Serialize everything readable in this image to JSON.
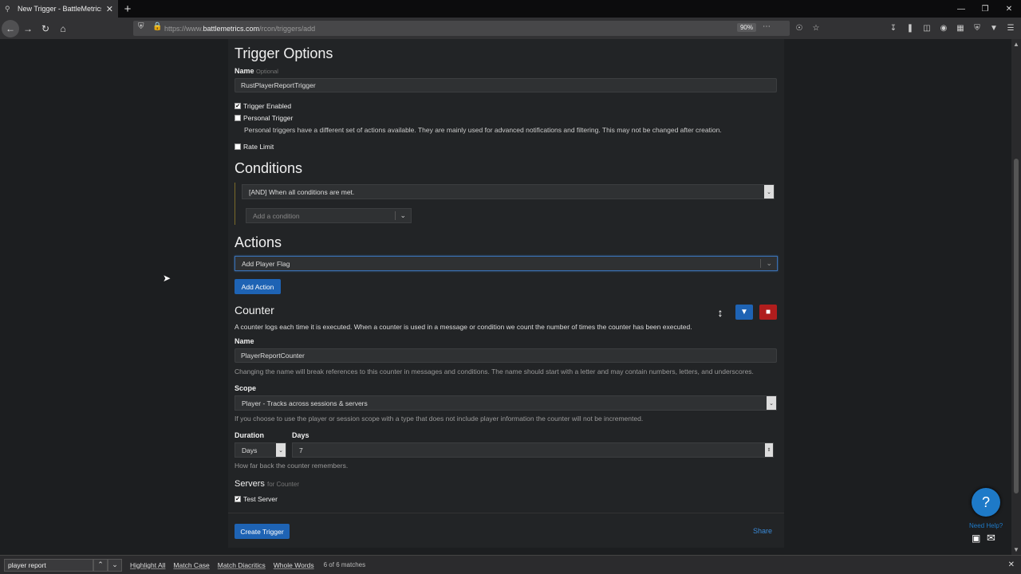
{
  "browser": {
    "tab_title": "New Trigger - BattleMetrics",
    "url_prefix": "https://www.",
    "url_domain": "battlemetrics.com",
    "url_path": "/rcon/triggers/add",
    "zoom": "90%"
  },
  "trigger_options": {
    "heading": "Trigger Options",
    "name_label": "Name",
    "name_optional": "Optional",
    "name_value": "RustPlayerReportTrigger",
    "trigger_enabled": "Trigger Enabled",
    "personal_trigger": "Personal Trigger",
    "personal_help": "Personal triggers have a different set of actions available. They are mainly used for advanced notifications and filtering. This may not be changed after creation.",
    "rate_limit": "Rate Limit"
  },
  "conditions": {
    "heading": "Conditions",
    "mode": "[AND] When all conditions are met.",
    "add_placeholder": "Add a condition"
  },
  "actions": {
    "heading": "Actions",
    "selected": "Add Player Flag",
    "add_button": "Add Action"
  },
  "counter": {
    "heading": "Counter",
    "description": "A counter logs each time it is executed. When a counter is used in a message or condition we count the number of times the counter has been executed.",
    "name_label": "Name",
    "name_value": "PlayerReportCounter",
    "name_help": "Changing the name will break references to this counter in messages and conditions. The name should start with a letter and may contain numbers, letters, and underscores.",
    "scope_label": "Scope",
    "scope_value": "Player - Tracks across sessions & servers",
    "scope_help": "If you choose to use the player or session scope with a type that does not include player information the counter will not be incremented.",
    "duration_label": "Duration",
    "duration_unit": "Days",
    "days_label": "Days",
    "days_value": "7",
    "duration_help": "How far back the counter remembers.",
    "servers_label": "Servers",
    "servers_sub": "for Counter",
    "server_name": "Test Server"
  },
  "footer": {
    "create_button": "Create Trigger",
    "share_link": "Share"
  },
  "help_widget": {
    "icon": "?",
    "label": "Need Help?"
  },
  "find_bar": {
    "query": "player report",
    "highlight_all": "Highlight All",
    "match_case": "Match Case",
    "match_diacritics": "Match Diacritics",
    "whole_words": "Whole Words",
    "status": "6 of 6 matches"
  }
}
